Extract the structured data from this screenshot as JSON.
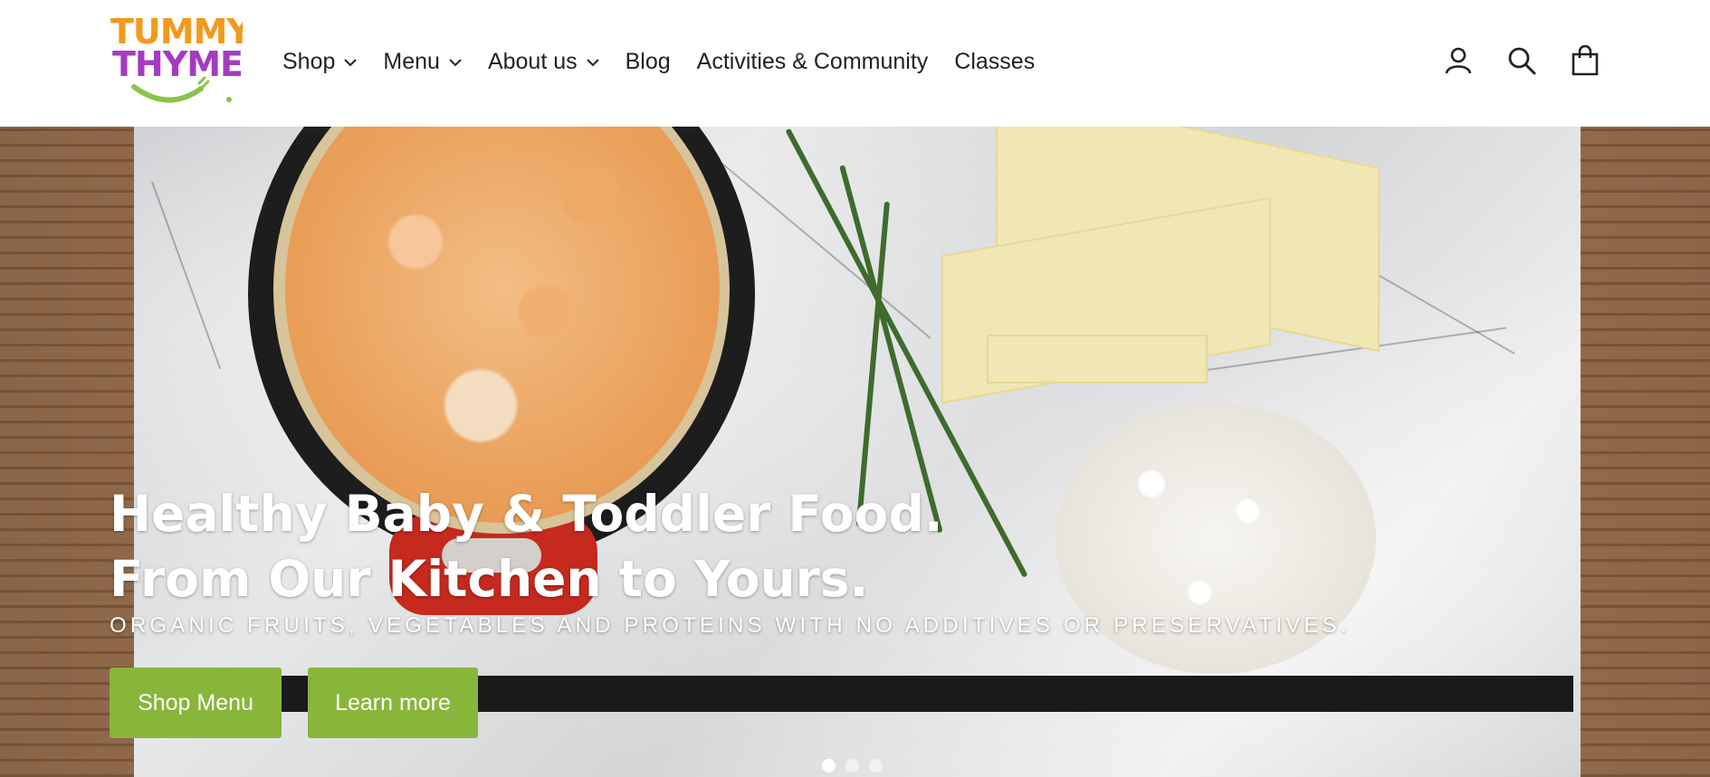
{
  "brand": {
    "line1": "TUMMY",
    "line2": "THYME",
    "colors": {
      "orange": "#f29a1c",
      "purple": "#a43bc2",
      "green": "#8bc34a"
    }
  },
  "nav": {
    "items": [
      {
        "label": "Shop",
        "has_dropdown": true
      },
      {
        "label": "Menu",
        "has_dropdown": true
      },
      {
        "label": "About us",
        "has_dropdown": true
      },
      {
        "label": "Blog",
        "has_dropdown": false
      },
      {
        "label": "Activities & Community",
        "has_dropdown": false
      },
      {
        "label": "Classes",
        "has_dropdown": false
      }
    ]
  },
  "header_icons": [
    "account-icon",
    "search-icon",
    "cart-icon"
  ],
  "hero": {
    "headline_line1": "Healthy Baby & Toddler Food.",
    "headline_line2": "From Our Kitchen to Yours.",
    "tagline": "ORGANIC FRUITS, VEGETABLES AND PROTEINS WITH NO ADDITIVES OR PRESERVATIVES.",
    "primary_button": "Shop Menu",
    "secondary_button": "Learn more",
    "slides_total": 3,
    "active_slide": 1
  },
  "accent_color": "#88b63a"
}
